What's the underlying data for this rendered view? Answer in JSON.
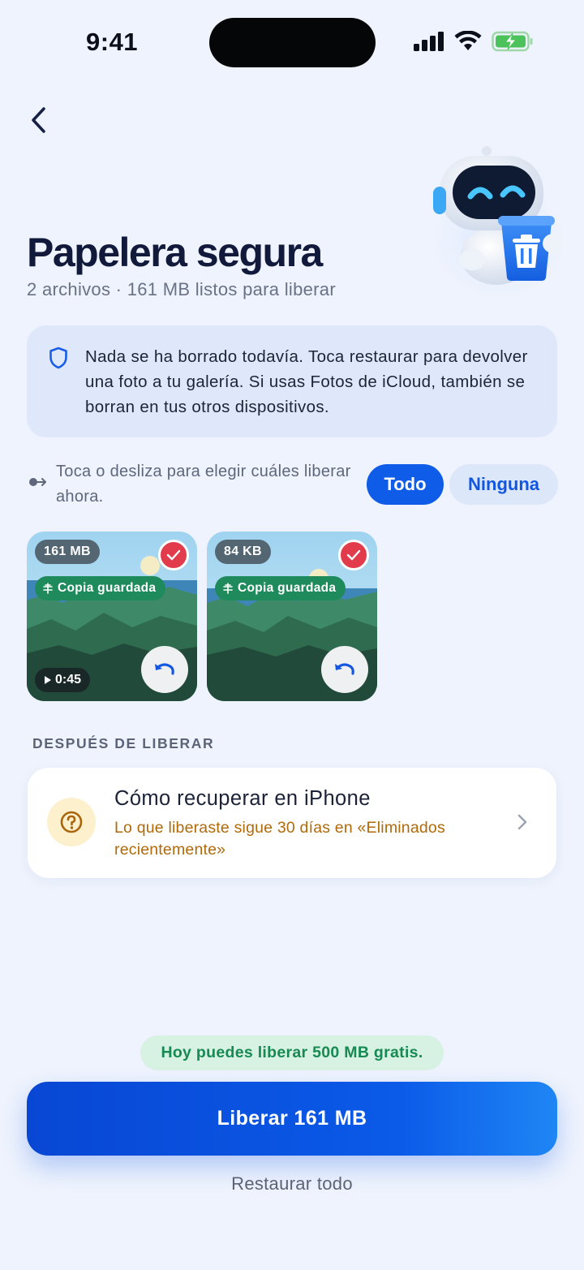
{
  "status_bar": {
    "time": "9:41"
  },
  "header": {
    "title": "Papelera segura",
    "subtitle": "2 archivos · 161 MB listos para liberar"
  },
  "notice": {
    "text": "Nada se ha borrado todavía. Toca restaurar para devolver una foto a tu galería. Si usas Fotos de iCloud, también se borran en tus otros dispositivos."
  },
  "selection": {
    "hint": "Toca o desliza para elegir cuáles liberar ahora.",
    "all_label": "Todo",
    "none_label": "Ninguna"
  },
  "items": [
    {
      "size": "161 MB",
      "badge": "Copia guardada",
      "duration": "0:45",
      "selected": true
    },
    {
      "size": "84 KB",
      "badge": "Copia guardada",
      "selected": true
    }
  ],
  "after_section": {
    "label": "DESPUÉS DE LIBERAR",
    "help_title": "Cómo recuperar en iPhone",
    "help_subtitle": "Lo que liberaste sigue 30 días en «Eliminados recientemente»"
  },
  "footer": {
    "free_quota": "Hoy puedes liberar 500 MB gratis.",
    "primary_button": "Liberar 161 MB",
    "secondary_link": "Restaurar todo"
  },
  "colors": {
    "background": "#eef3fd",
    "accent": "#0f5ce8",
    "danger": "#e23b4c",
    "success": "#1f8b5c",
    "warning_text": "#b06a0a"
  },
  "icons": [
    "back-chevron-icon",
    "shield-icon",
    "swipe-key-icon",
    "check-icon",
    "copy-saved-icon",
    "play-icon",
    "undo-icon",
    "question-icon",
    "chevron-right-icon"
  ]
}
